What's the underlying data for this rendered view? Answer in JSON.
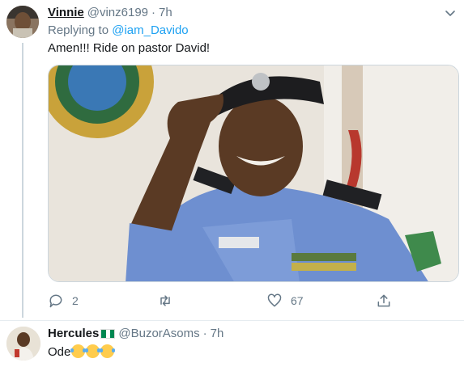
{
  "tweets": [
    {
      "name": "Vinnie",
      "handle": "@vinz6199",
      "separator": "·",
      "time": "7h",
      "replying_prefix": "Replying to",
      "replying_to": "@iam_Davido",
      "text": "Amen!!! Ride on pastor David!",
      "replies": "2",
      "retweets": "",
      "likes": "67"
    },
    {
      "name": "Hercules",
      "handle": "@BuzorAsoms",
      "separator": "·",
      "time": "7h",
      "text": "Ode"
    }
  ],
  "colors": {
    "accent": "#1da1f2",
    "secondary_text": "#657786",
    "divider": "#e6ecf0",
    "flag_green": "#008751"
  },
  "icons": [
    "chevron-down-icon",
    "reply-icon",
    "retweet-icon",
    "like-icon",
    "share-icon",
    "nigeria-flag-icon",
    "laughing-crying-emoji-icon"
  ]
}
